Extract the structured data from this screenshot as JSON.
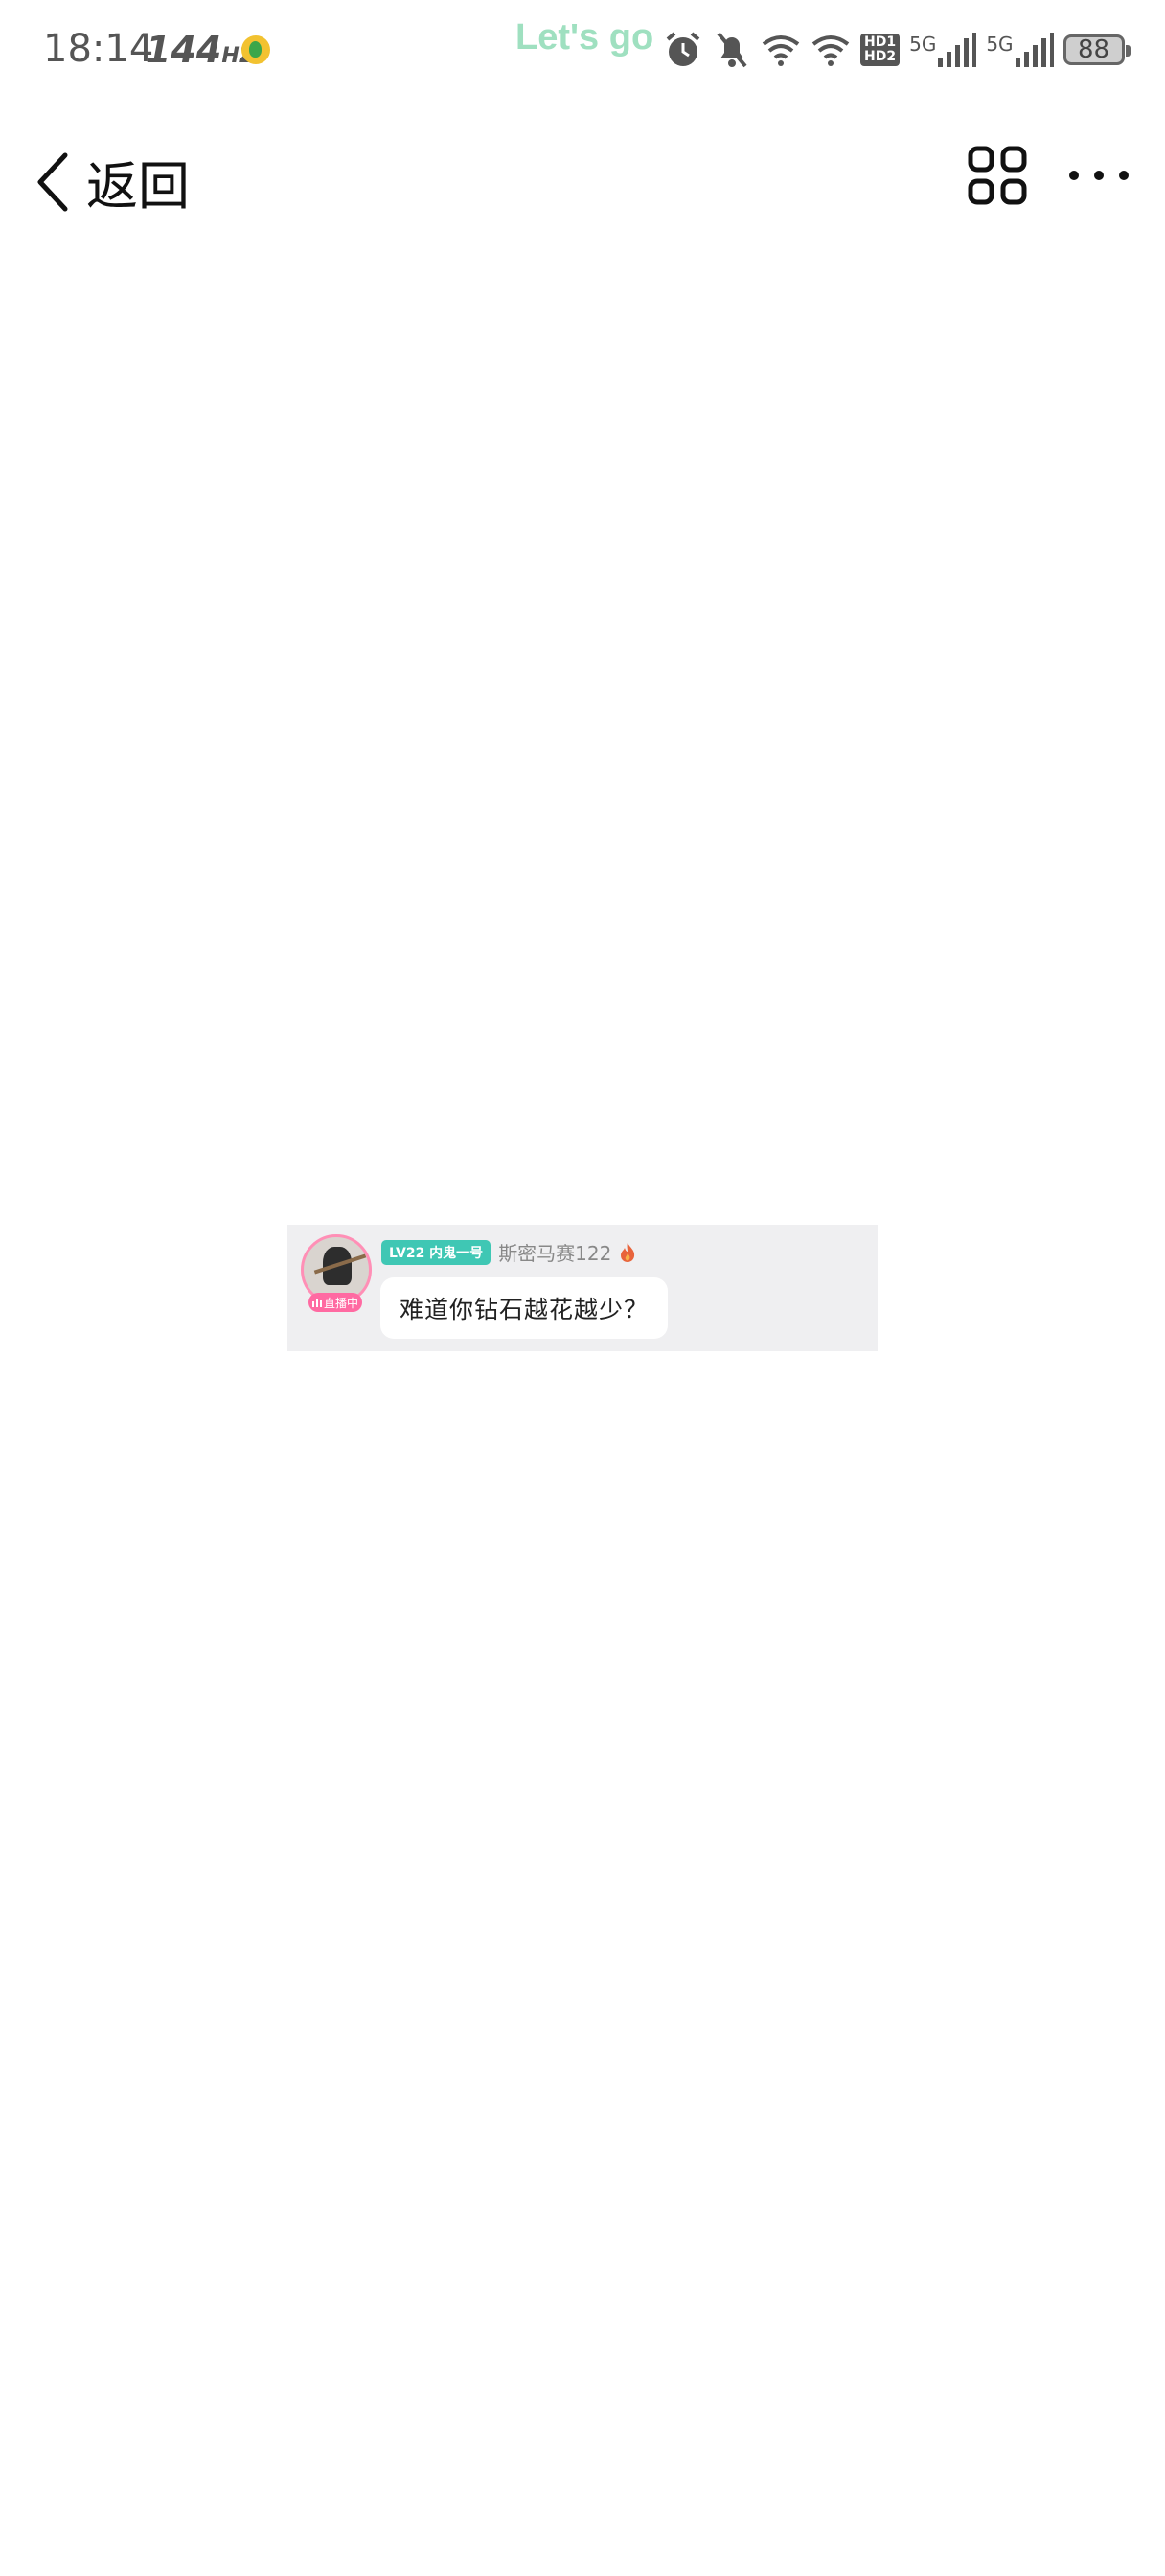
{
  "status_bar": {
    "time": "18:14",
    "refresh_rate": "144",
    "refresh_unit": "HZ",
    "overlay_text": "Let's go",
    "hd_top": "HD1",
    "hd_bottom": "HD2",
    "network1": "5G",
    "network2": "5G",
    "battery": "88"
  },
  "nav": {
    "back_label": "返回",
    "icons": [
      "chevron-left-icon",
      "grid-icon",
      "more-icon"
    ]
  },
  "message": {
    "level_badge": "LV22 内鬼一号",
    "username": "斯密马赛122",
    "live_badge": "直播中",
    "text": "难道你钻石越花越少？",
    "colors": {
      "level_badge": "#3fc7b4",
      "live_badge": "#ff6aa2",
      "card_bg": "#efeff1"
    }
  }
}
